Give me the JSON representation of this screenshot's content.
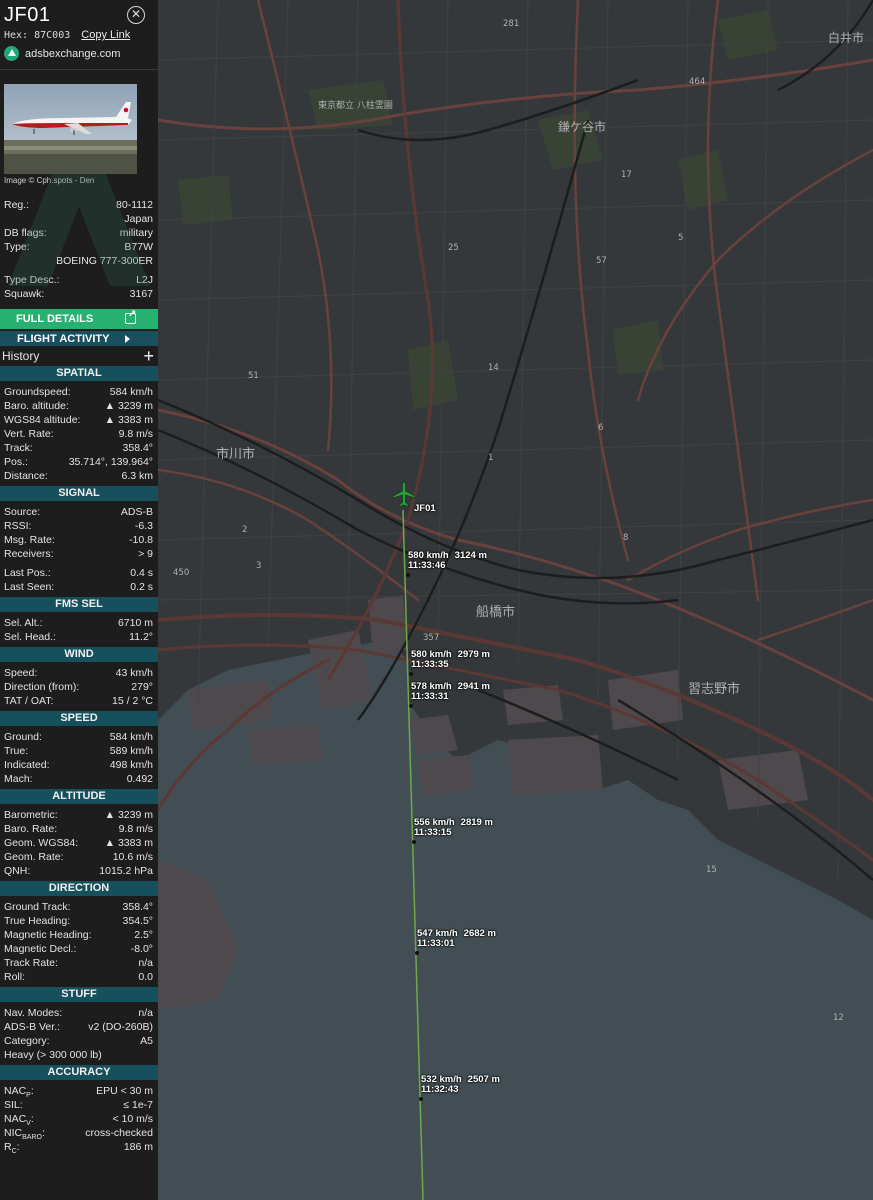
{
  "header": {
    "callsign": "JF01",
    "hex_label": "Hex:",
    "hex": "87C003",
    "copy_link": "Copy Link",
    "site": "adsbexchange.com"
  },
  "photo": {
    "credit": "Image © Cph.spots - Den"
  },
  "aircraft": {
    "reg_label": "Reg.:",
    "reg": "80-1112",
    "country": "Japan",
    "dbflags_label": "DB flags:",
    "dbflags": "military",
    "type_label": "Type:",
    "type": "B77W",
    "type_full": "BOEING 777-300ER",
    "typedesc_label": "Type Desc.:",
    "typedesc": "L2J",
    "squawk_label": "Squawk:",
    "squawk": "3167"
  },
  "buttons": {
    "full_details": "FULL DETAILS",
    "flight_activity": "FLIGHT ACTIVITY",
    "history": "History",
    "history_add": "+"
  },
  "sections": [
    {
      "title": "SPATIAL",
      "rows": [
        [
          "Groundspeed:",
          "584 km/h"
        ],
        [
          "Baro. altitude:",
          "▲ 3239 m"
        ],
        [
          "WGS84 altitude:",
          "▲ 3383 m"
        ],
        [
          "Vert. Rate:",
          "9.8 m/s"
        ],
        [
          "Track:",
          "358.4°"
        ],
        [
          "Pos.:",
          "35.714°, 139.964°"
        ],
        [
          "Distance:",
          "6.3 km"
        ]
      ]
    },
    {
      "title": "SIGNAL",
      "rows": [
        [
          "Source:",
          "ADS-B"
        ],
        [
          "RSSI:",
          "-6.3"
        ],
        [
          "Msg. Rate:",
          "-10.8"
        ],
        [
          "Receivers:",
          "> 9"
        ],
        [
          "",
          ""
        ],
        [
          "Last Pos.:",
          "0.4 s"
        ],
        [
          "Last Seen:",
          "0.2 s"
        ]
      ]
    },
    {
      "title": "FMS SEL",
      "rows": [
        [
          "Sel. Alt.:",
          "6710 m"
        ],
        [
          "Sel. Head.:",
          "11.2°"
        ]
      ]
    },
    {
      "title": "WIND",
      "rows": [
        [
          "Speed:",
          "43 km/h"
        ],
        [
          "Direction (from):",
          "279°"
        ],
        [
          "TAT / OAT:",
          "15 / 2 °C"
        ]
      ]
    },
    {
      "title": "SPEED",
      "rows": [
        [
          "Ground:",
          "584 km/h"
        ],
        [
          "True:",
          "589 km/h"
        ],
        [
          "Indicated:",
          "498 km/h"
        ],
        [
          "Mach:",
          "0.492"
        ]
      ]
    },
    {
      "title": "ALTITUDE",
      "rows": [
        [
          "Barometric:",
          "▲ 3239 m"
        ],
        [
          "Baro. Rate:",
          "9.8 m/s"
        ],
        [
          "Geom. WGS84:",
          "▲ 3383 m"
        ],
        [
          "Geom. Rate:",
          "10.6 m/s"
        ],
        [
          "QNH:",
          "1015.2 hPa"
        ]
      ]
    },
    {
      "title": "DIRECTION",
      "rows": [
        [
          "Ground Track:",
          "358.4°"
        ],
        [
          "True Heading:",
          "354.5°"
        ],
        [
          "Magnetic Heading:",
          "2.5°"
        ],
        [
          "Magnetic Decl.:",
          "-8.0°"
        ],
        [
          "Track Rate:",
          "n/a"
        ],
        [
          "Roll:",
          "0.0"
        ]
      ]
    },
    {
      "title": "STUFF",
      "rows": [
        [
          "Nav. Modes:",
          "n/a"
        ],
        [
          "ADS-B Ver.:",
          "v2 (DO-260B)"
        ],
        [
          "Category:",
          "A5"
        ],
        [
          "Heavy (> 300 000 lb)",
          ""
        ]
      ]
    },
    {
      "title": "ACCURACY",
      "rows": [
        [
          "NACP:",
          "EPU < 30 m"
        ],
        [
          "SIL:",
          "≤ 1e-7"
        ],
        [
          "NACV:",
          "< 10 m/s"
        ],
        [
          "NICBARO:",
          "cross-checked"
        ],
        [
          "RC:",
          "186 m"
        ]
      ]
    }
  ],
  "map": {
    "aircraft_label": "JF01",
    "aircraft_color": "#2e9e3a",
    "track_color": "#7ec850",
    "track_points": [
      {
        "speed": "580 km/h",
        "alt": "3124 m",
        "time": "11:33:46"
      },
      {
        "speed": "580 km/h",
        "alt": "2979 m",
        "time": "11:33:35"
      },
      {
        "speed": "578 km/h",
        "alt": "2941 m",
        "time": "11:33:31"
      },
      {
        "speed": "556 km/h",
        "alt": "2819 m",
        "time": "11:33:15"
      },
      {
        "speed": "547 km/h",
        "alt": "2682 m",
        "time": "11:33:01"
      },
      {
        "speed": "532 km/h",
        "alt": "2507 m",
        "time": "11:32:43"
      }
    ],
    "places": [
      "市川市",
      "船橋市",
      "習志野市",
      "鎌ケ谷市",
      "白井市",
      "東京都立 八柱霊園"
    ],
    "road_numbers": [
      "281",
      "464",
      "17",
      "57",
      "51",
      "25",
      "1",
      "6",
      "357",
      "14",
      "450",
      "8",
      "5",
      "15",
      "12",
      "2",
      "3"
    ]
  }
}
